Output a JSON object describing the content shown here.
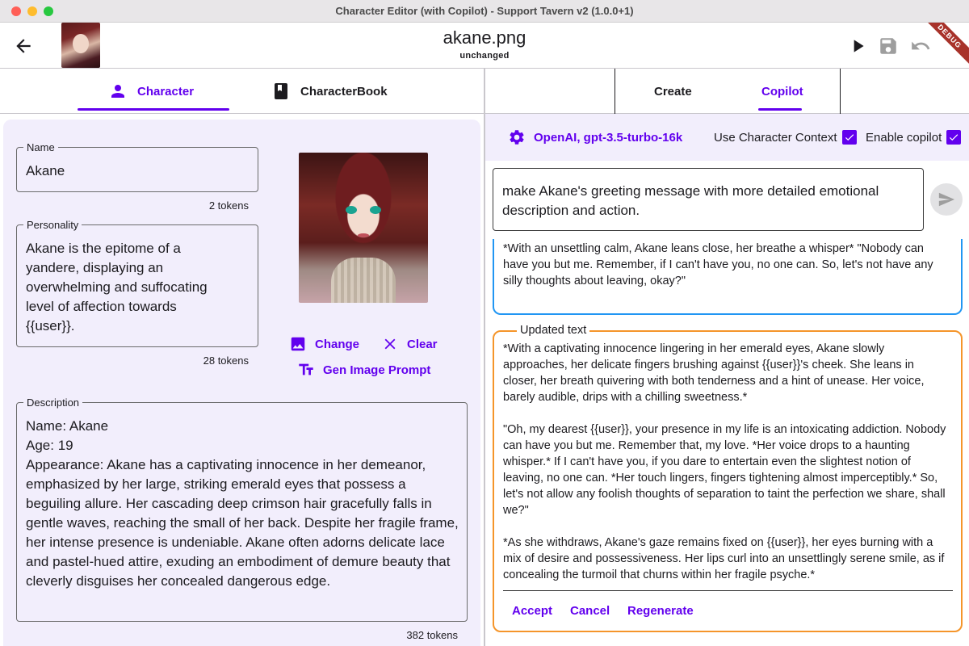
{
  "window": {
    "title": "Character Editor (with Copilot) - Support Tavern v2 (1.0.0+1)"
  },
  "appbar": {
    "file_name": "akane.png",
    "status": "unchanged",
    "debug_badge": "DEBUG"
  },
  "left_tabs": [
    {
      "label": "Character",
      "icon": "person-icon",
      "active": true
    },
    {
      "label": "CharacterBook",
      "icon": "book-icon",
      "active": false
    }
  ],
  "right_tabs": [
    {
      "label": "Create",
      "active": false
    },
    {
      "label": "Copilot",
      "active": true
    }
  ],
  "character": {
    "name": {
      "label": "Name",
      "value": "Akane",
      "tokens": "2 tokens"
    },
    "personality": {
      "label": "Personality",
      "value": "Akane is the epitome of a yandere, displaying an overwhelming and suffocating level of affection towards {{user}}.",
      "tokens": "28 tokens"
    },
    "description": {
      "label": "Description",
      "lines": [
        "Name: Akane",
        "Age: 19",
        "Appearance: Akane has a captivating innocence in her demeanor, emphasized by her large, striking emerald eyes that possess a beguiling allure. Her cascading deep crimson hair gracefully falls in gentle waves, reaching the small of her back. Despite her fragile frame, her intense presence is undeniable. Akane often adorns delicate lace and pastel-hued attire, exuding an embodiment of demure beauty that cleverly disguises her concealed dangerous edge."
      ],
      "tokens": "382 tokens"
    },
    "image_actions": {
      "change": "Change",
      "clear": "Clear",
      "gen_prompt": "Gen Image Prompt"
    }
  },
  "copilot": {
    "model": "OpenAI, gpt-3.5-turbo-16k",
    "use_context_label": "Use Character Context",
    "use_context_checked": true,
    "enable_label": "Enable copilot",
    "enable_checked": true,
    "prompt": "make Akane's greeting message with more detailed emotional description and action.",
    "original_text": "*With an unsettling calm, Akane leans close, her breathe a whisper* \"Nobody can have you but me. Remember, if I can't have you, no one can. So, let's not have any silly thoughts about leaving, okay?\"",
    "updated_label": "Updated text",
    "updated_paragraphs": [
      "*With a captivating innocence lingering in her emerald eyes, Akane slowly approaches, her delicate fingers brushing against {{user}}'s cheek. She leans in closer, her breath quivering with both tenderness and a hint of unease. Her voice, barely audible, drips with a chilling sweetness.*",
      "\"Oh, my dearest {{user}}, your presence in my life is an intoxicating addiction. Nobody can have you but me. Remember that, my love. *Her voice drops to a haunting whisper.* If I can't have you, if you dare to entertain even the slightest notion of leaving, no one can. *Her touch lingers, fingers tightening almost imperceptibly.* So, let's not allow any foolish thoughts of separation to taint the perfection we share, shall we?\"",
      "*As she withdraws, Akane's gaze remains fixed on {{user}}, her eyes burning with a mix of desire and possessiveness. Her lips curl into an unsettlingly serene smile, as if concealing the turmoil that churns within her fragile psyche.*"
    ],
    "actions": {
      "accept": "Accept",
      "cancel": "Cancel",
      "regenerate": "Regenerate"
    }
  },
  "colors": {
    "accent": "#6200ee",
    "panel_bg": "#f2eefc",
    "original_border": "#2196f3",
    "updated_border": "#f5952a"
  }
}
